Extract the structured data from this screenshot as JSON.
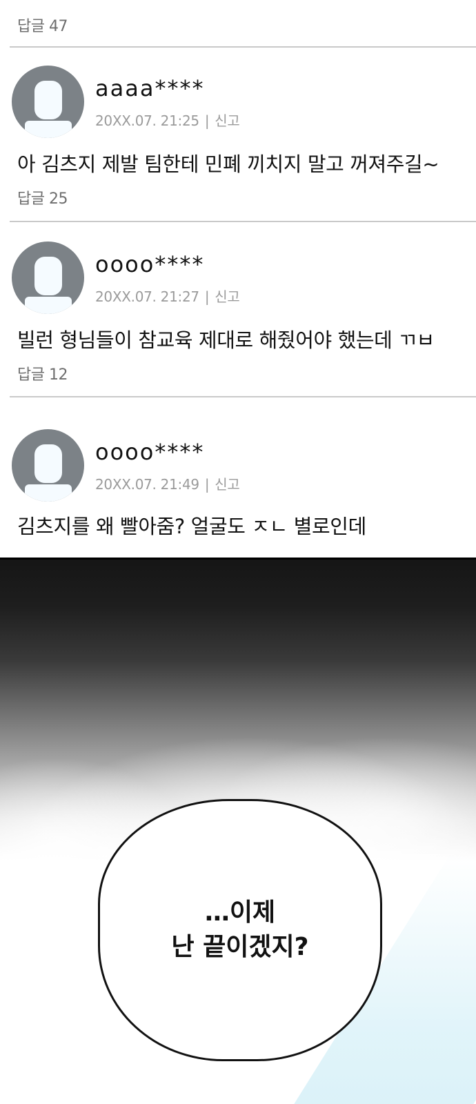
{
  "comments_section": {
    "top_reply": {
      "label": "답글 47"
    },
    "comments": [
      {
        "username": "aaaa****",
        "timestamp": "20XX.07. 21:25",
        "separator": "|",
        "report_label": "신고",
        "text": "아 김츠지 제발 팀한테 민폐 끼치지 말고 꺼져주길~",
        "reply_label": "답글 25"
      },
      {
        "username": "oooo****",
        "timestamp": "20XX.07. 21:27",
        "separator": "|",
        "report_label": "신고",
        "text": "빌런 형님들이 참교육 제대로 해줬어야 했는데 ㄲㅂ",
        "reply_label": "답글 12"
      },
      {
        "username": "oooo****",
        "timestamp": "20XX.07. 21:49",
        "separator": "|",
        "report_label": "신고",
        "text": "김츠지를 왜 빨아줌? 얼굴도 ㅈㄴ 별로인데"
      }
    ]
  },
  "manga_panel": {
    "speech_bubble": {
      "line1": "…이제",
      "line2": "난 끝이겠지?"
    }
  },
  "colors": {
    "avatar_bg": "#7c8287",
    "avatar_fg": "#f5fbff",
    "meta_text": "#9a9a9a",
    "reply_text": "#6e6e6e",
    "divider": "#c9c9c9"
  },
  "icons": {
    "avatar": "default-user-icon"
  }
}
